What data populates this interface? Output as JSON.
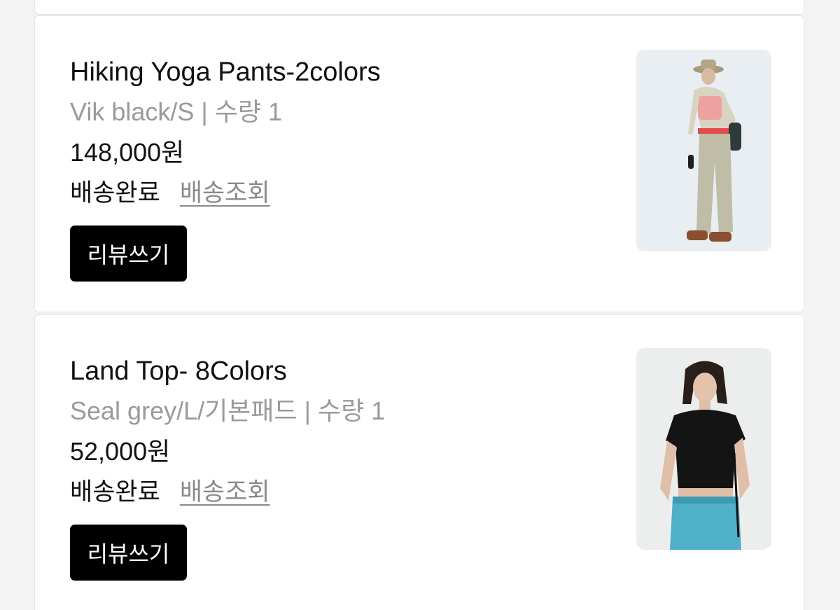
{
  "orders": [
    {
      "name": "Hiking Yoga Pants-2colors",
      "option": "Vik black/S | 수량 1",
      "price": "148,000원",
      "status": "배송완료",
      "track_label": "배송조회",
      "review_label": "리뷰쓰기",
      "image_icon": "product-photo-hiking-yoga-pants"
    },
    {
      "name": "Land Top- 8Colors",
      "option": "Seal grey/L/기본패드 | 수량 1",
      "price": "52,000원",
      "status": "배송완료",
      "track_label": "배송조회",
      "review_label": "리뷰쓰기",
      "image_icon": "product-photo-land-top"
    }
  ]
}
